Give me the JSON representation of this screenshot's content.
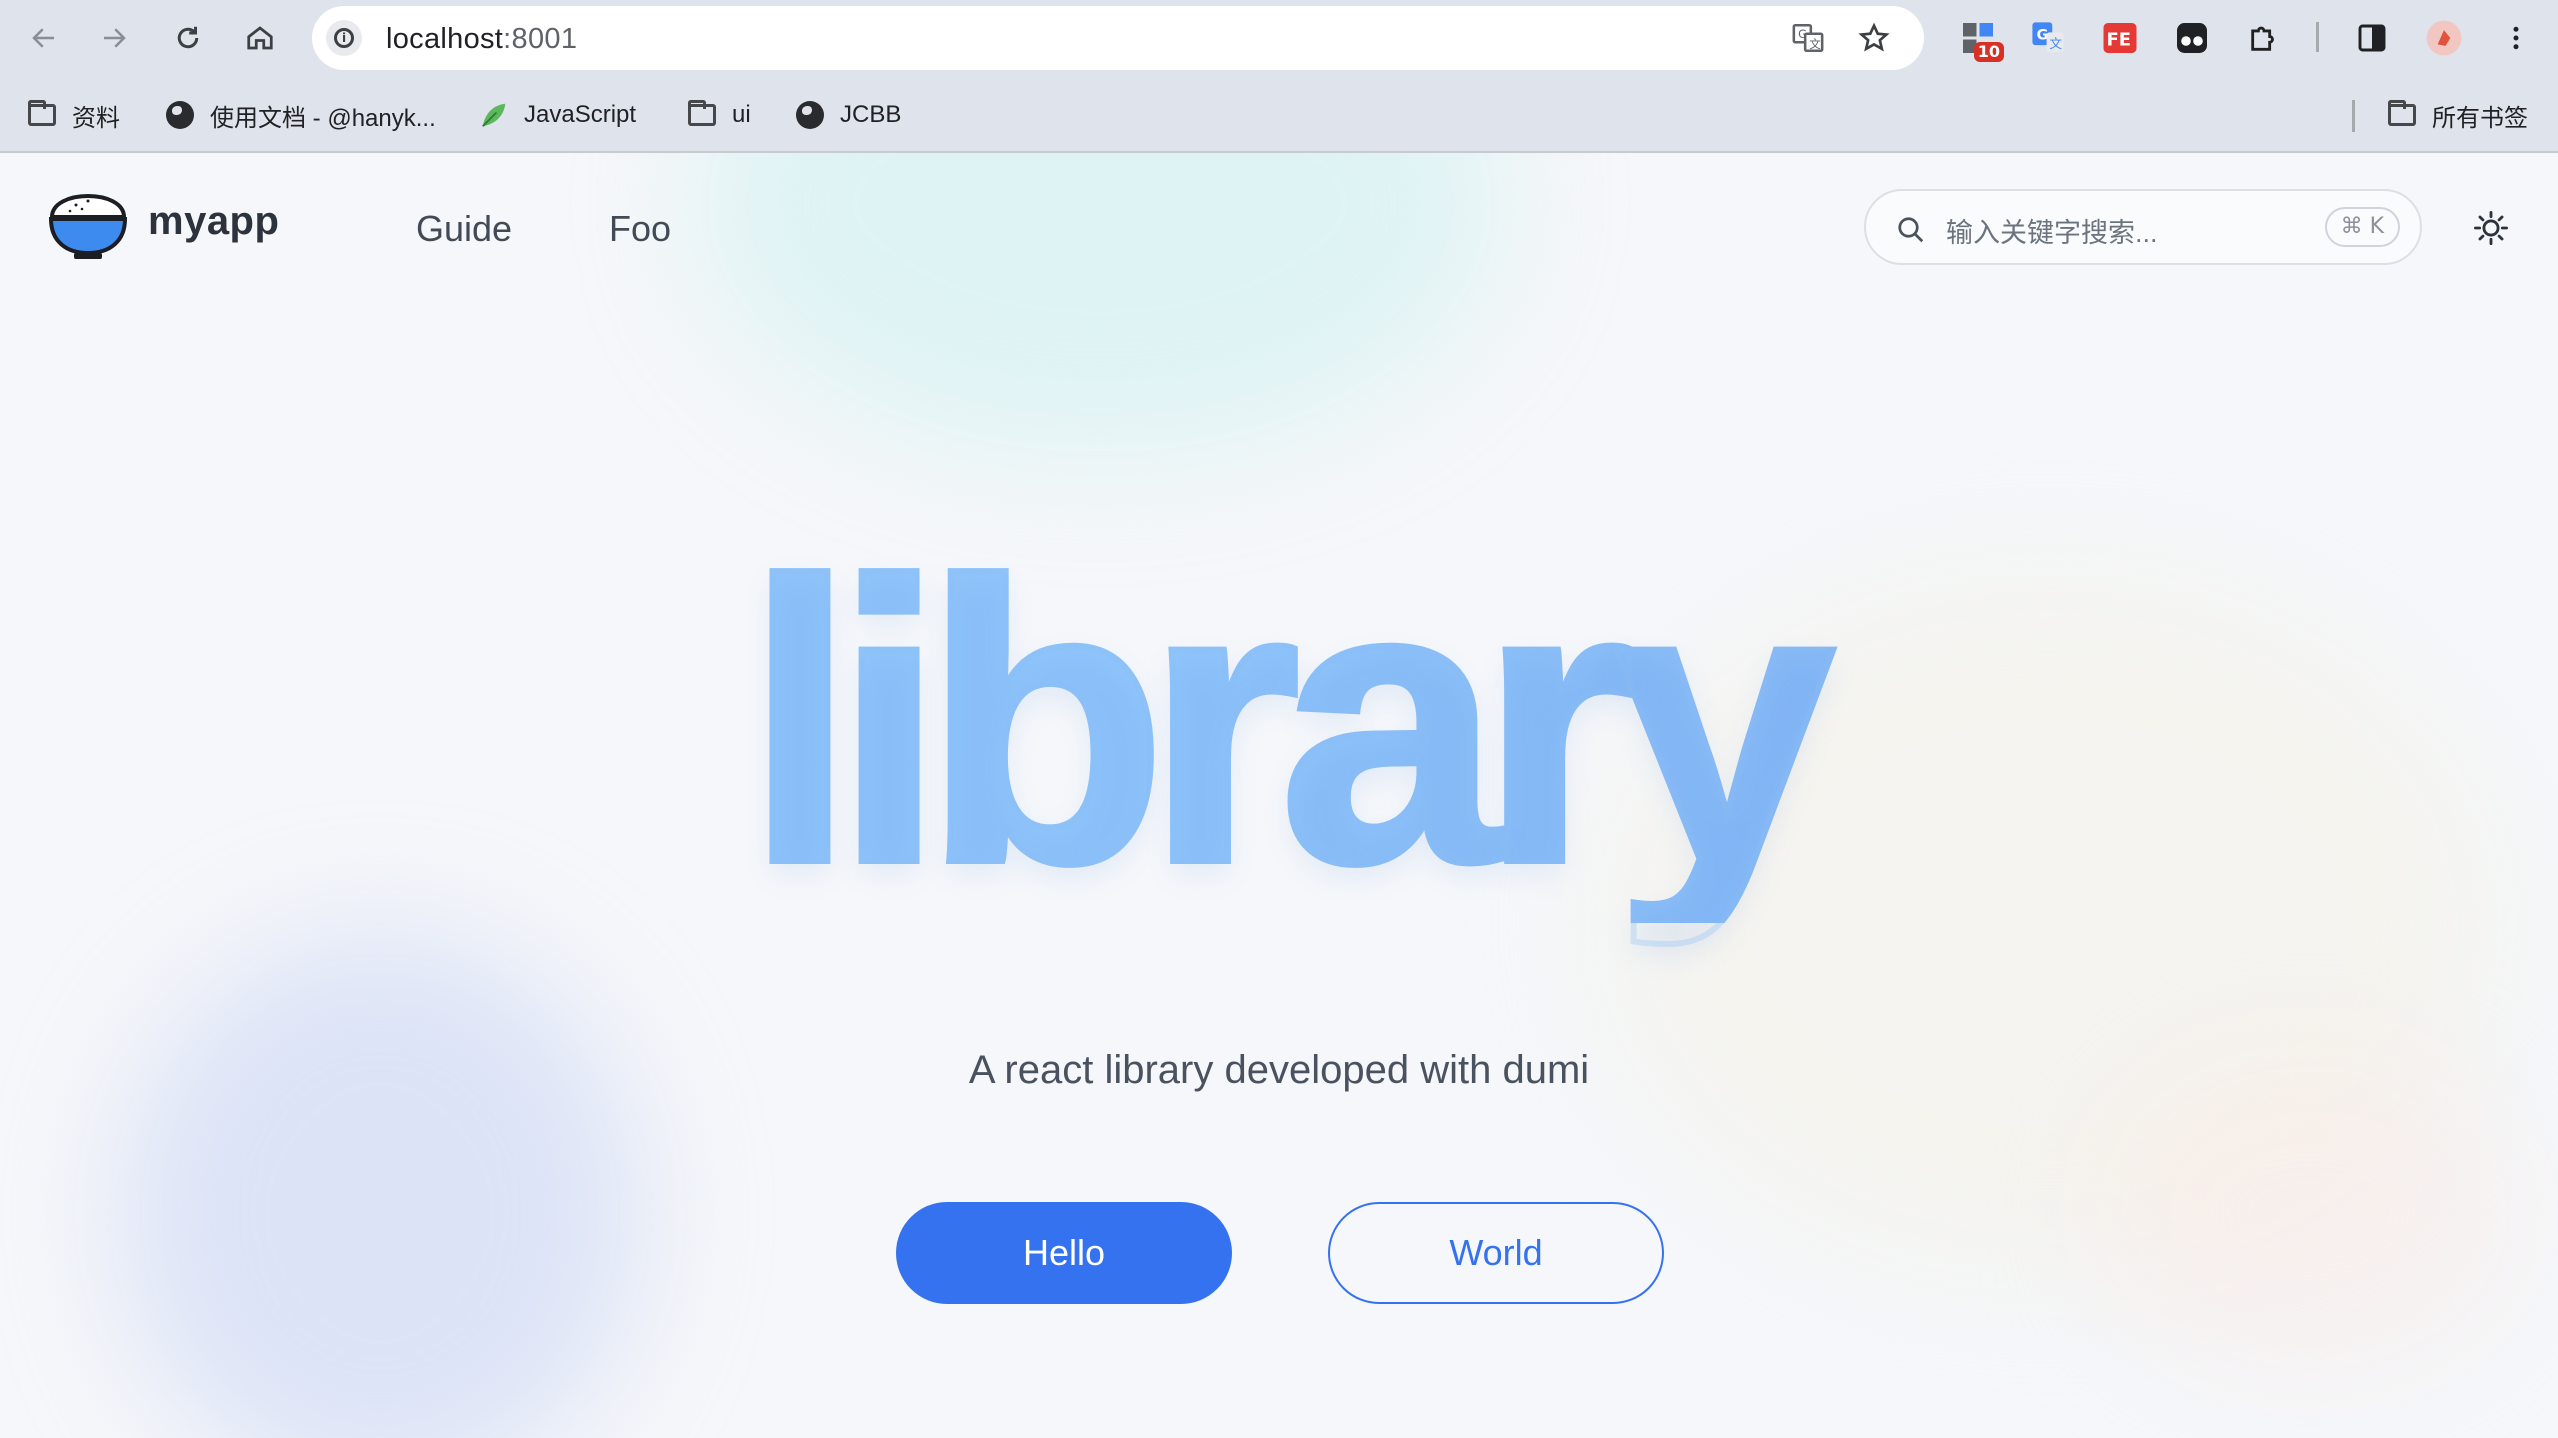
{
  "browser": {
    "url_host": "localhost",
    "url_port": ":8001",
    "badge_count": "10",
    "ext_fe_label": "FE",
    "bookmarks": [
      {
        "label": "资料",
        "icon": "folder-icon"
      },
      {
        "label": "使用文档 - @hanyk...",
        "icon": "globe-icon"
      },
      {
        "label": "JavaScript",
        "icon": "leaf-icon"
      },
      {
        "label": "ui",
        "icon": "folder-icon"
      },
      {
        "label": "JCBB",
        "icon": "globe-icon"
      }
    ],
    "all_bookmarks": "所有书签"
  },
  "site": {
    "app_name": "myapp",
    "nav": [
      "Guide",
      "Foo"
    ],
    "search_placeholder": "输入关键字搜索...",
    "search_shortcut": "⌘ K"
  },
  "hero": {
    "title": "library",
    "description": "A react library developed with dumi",
    "actions": [
      "Hello",
      "World"
    ]
  },
  "colors": {
    "primary": "#3572ef",
    "title_gradient_start": "#8fc3f7",
    "title_gradient_end": "#7cabef"
  }
}
